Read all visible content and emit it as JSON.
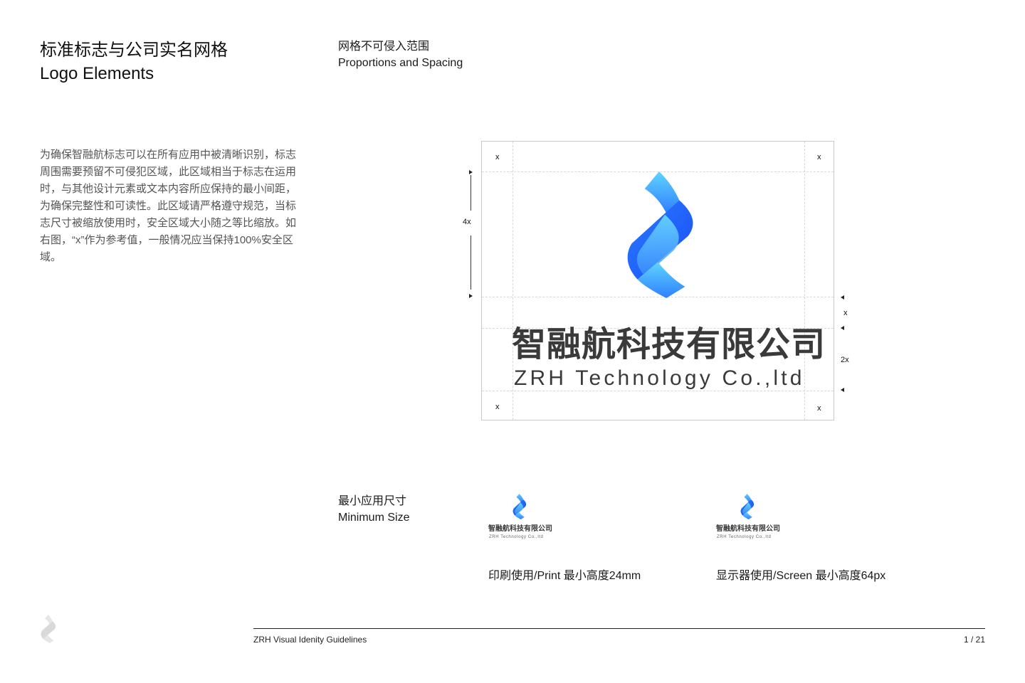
{
  "header": {
    "title_cn": "标准标志与公司实名网格",
    "title_en": "Logo Elements",
    "subtitle_cn": "网格不可侵入范围",
    "subtitle_en": "Proportions and Spacing"
  },
  "description": "为确保智融航标志可以在所有应用中被清晰识别，标志周围需要预留不可侵犯区域，此区域相当于标志在运用时，与其他设计元素或文本内容所应保持的最小间距，为确保完整性和可读性。此区域请严格遵守规范，当标志尺寸被缩放使用时，安全区域大小随之等比缩放。如右图，“x”作为参考值，一般情况应当保持100%安全区域。",
  "grid": {
    "x_label": "x",
    "dim_4x": "4x",
    "dim_x": "x",
    "dim_2x": "2x"
  },
  "logo": {
    "name_cn": "智融航科技有限公司",
    "name_en": "ZRH Technology Co.,ltd",
    "colors": {
      "blue_dark": "#1a4ef5",
      "blue_mid": "#2f80ff",
      "cyan": "#5fd4ff"
    }
  },
  "minimum_size": {
    "title_cn": "最小应用尺寸",
    "title_en": "Minimum Size",
    "print_caption": "印刷使用/Print 最小高度24mm",
    "screen_caption": "显示器使用/Screen 最小高度64px"
  },
  "footer": {
    "title": "ZRH Visual Idenity Guidelines",
    "page": "1 / 21"
  }
}
